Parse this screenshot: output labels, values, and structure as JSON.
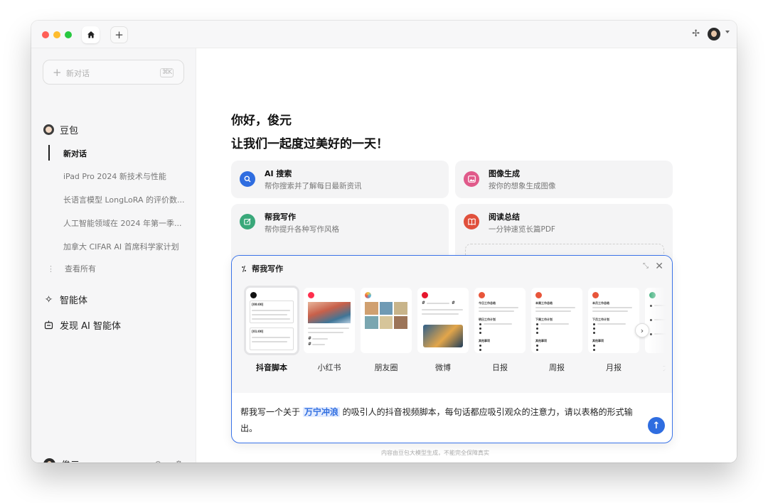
{
  "titlebar": {
    "home_icon": "home-icon",
    "new_tab_icon": "plus-icon",
    "pin_icon": "pin-icon"
  },
  "sidebar": {
    "new_chat_label": "新对话",
    "new_chat_shortcut": "⌘K",
    "bot_name": "豆包",
    "history": [
      "新对话",
      "iPad Pro 2024 新技术与性能",
      "长语言模型 LongLoRA 的评价数...",
      "人工智能领域在 2024 年第一季...",
      "加拿大 CIFAR AI 首席科学家计划"
    ],
    "view_all": "查看所有",
    "agents": "智能体",
    "discover": "发现 AI 智能体",
    "user_name": "俊元"
  },
  "main": {
    "greeting_line1": "你好，俊元",
    "greeting_line2": "让我们一起度过美好的一天！",
    "cards": [
      {
        "title": "AI 搜索",
        "subtitle": "帮你搜索并了解每日最新资讯",
        "color": "#2f6de0"
      },
      {
        "title": "图像生成",
        "subtitle": "按你的想象生成图像",
        "color": "#e05a8a"
      },
      {
        "title": "帮我写作",
        "subtitle": "帮你提升各种写作风格",
        "color": "#39a87a"
      },
      {
        "title": "阅读总结",
        "subtitle": "一分钟速览长篇PDF",
        "color": "#e0503c"
      }
    ],
    "disclaimer": "内容由豆包大模型生成，不能完全保障真实"
  },
  "panel": {
    "title": "帮我写作",
    "templates": [
      "抖音脚本",
      "小红书",
      "朋友圈",
      "微博",
      "日报",
      "周报",
      "月报",
      "大纲"
    ],
    "template_texts": {
      "time1": "[00:00]",
      "time2": "[01:00]",
      "daily": "今日工作总结",
      "daily_next": "明日工作计划",
      "weekly": "本周工作总结",
      "weekly_next": "下周工作计划",
      "monthly": "本月工作总结",
      "monthly_next": "下月工作计划",
      "other": "其他事项"
    },
    "prompt_before": "帮我写一个关于 ",
    "prompt_highlight": "万宁冲浪",
    "prompt_after": " 的吸引人的抖音视频脚本，每句话都应吸引观众的注意力，请以表格的形式输出。"
  },
  "colors": {
    "accent": "#2f6de0",
    "traffic_red": "#ff5f57",
    "traffic_yellow": "#febc2e",
    "traffic_green": "#28c840"
  }
}
